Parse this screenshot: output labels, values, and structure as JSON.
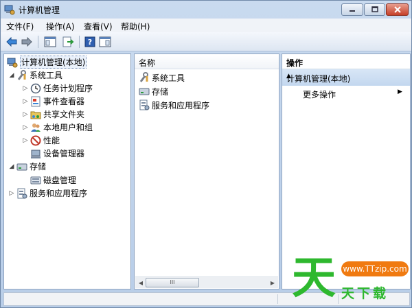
{
  "window": {
    "title": "计算机管理"
  },
  "menubar": {
    "items": [
      "文件(F)",
      "操作(A)",
      "查看(V)",
      "帮助(H)"
    ]
  },
  "toolbar": {
    "buttons": [
      "back-arrow-icon",
      "forward-arrow-icon",
      "console-tree-icon",
      "export-list-icon",
      "help-icon",
      "properties-icon"
    ]
  },
  "tree": {
    "root": "计算机管理(本地)",
    "system_tools": "系统工具",
    "task_scheduler": "任务计划程序",
    "event_viewer": "事件查看器",
    "shared_folders": "共享文件夹",
    "local_users": "本地用户和组",
    "performance": "性能",
    "device_manager": "设备管理器",
    "storage": "存储",
    "disk_management": "磁盘管理",
    "services_apps": "服务和应用程序"
  },
  "list": {
    "header": "名称",
    "items": [
      "系统工具",
      "存储",
      "服务和应用程序"
    ],
    "scroll_thumb": "III"
  },
  "actions": {
    "header": "操作",
    "section": "计算机管理(本地)",
    "more": "更多操作"
  },
  "watermark": {
    "big_char": "天",
    "badge": "www.TTzip.com",
    "text": "天下载"
  },
  "colors": {
    "titlebar": "#c9daef",
    "action_section": "#c3d7ef",
    "watermark_green": "#2eb82e",
    "watermark_orange": "#f07a10"
  }
}
